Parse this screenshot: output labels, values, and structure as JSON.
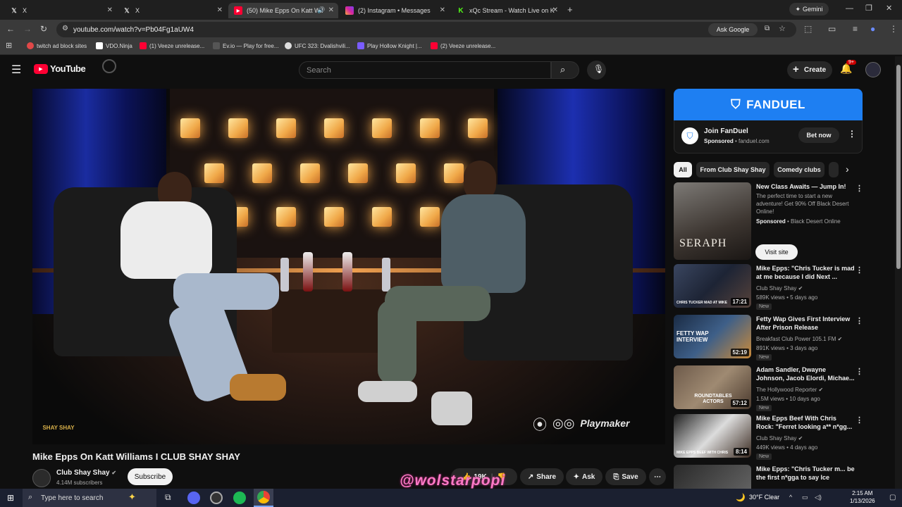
{
  "browser": {
    "tabs": [
      {
        "label": "X",
        "icon": "x-logo-icon"
      },
      {
        "label": "X",
        "icon": "x-logo-icon"
      },
      {
        "label": "(50) Mike Epps On Katt Wil",
        "icon": "youtube-icon"
      },
      {
        "label": "(2) Instagram • Messages",
        "icon": "instagram-icon"
      },
      {
        "label": "xQc Stream - Watch Live on K",
        "icon": "kick-icon"
      }
    ],
    "gemini_label": "Gemini",
    "url": "youtube.com/watch?v=Pb04Fg1aUW4",
    "ask_google": "Ask Google",
    "bookmarks": [
      "twitch ad block sites",
      "VDO.Ninja",
      "(1) Veeze unrelease...",
      "Ev.io — Play for free...",
      "UFC 323: Dvalishvili...",
      "Play Hollow Knight |...",
      "(2) Veeze unrelease..."
    ]
  },
  "youtube": {
    "logo_text": "YouTube",
    "search_placeholder": "Search",
    "create_label": "Create",
    "notif_count": "9+"
  },
  "video": {
    "title": "Mike Epps On Katt Williams I CLUB SHAY SHAY",
    "channel": "Club Shay Shay",
    "subscribers": "4.14M subscribers",
    "subscribe_label": "Subscribe",
    "like_count": "19K",
    "share_label": "Share",
    "ask_label": "Ask",
    "save_label": "Save",
    "overlay_logo": "SHAY SHAY",
    "overlay_brand": "Playmaker"
  },
  "ad": {
    "brand": "FANDUEL",
    "title": "Join FanDuel",
    "sponsored": "Sponsored",
    "domain": "fanduel.com",
    "cta": "Bet now"
  },
  "chips": [
    "All",
    "From Club Shay Shay",
    "Comedy clubs"
  ],
  "recommendations": [
    {
      "title": "New Class Awaits — Jump In!",
      "desc": "The perfect time to start a new adventure! Get 90% Off Black Desert Online!",
      "sponsored": "Sponsored",
      "advertiser": "Black Desert Online",
      "cta": "Visit site",
      "thumb_text": "SERAPH"
    },
    {
      "title": "Mike Epps: \"Chris Tucker is mad at me because I did Next ...",
      "channel": "Club Shay Shay",
      "meta": "589K views • 5 days ago",
      "badge": "New",
      "duration": "17:21",
      "thumb_text": "CHRIS TUCKER MAD AT MIKE"
    },
    {
      "title": "Fetty Wap Gives First Interview After Prison Release",
      "channel": "Breakfast Club Power 105.1 FM",
      "meta": "891K views • 3 days ago",
      "badge": "New",
      "duration": "52:19",
      "thumb_text": "FETTY WAP INTERVIEW"
    },
    {
      "title": "Adam Sandler, Dwayne Johnson, Jacob Elordi, Michae...",
      "channel": "The Hollywood Reporter",
      "meta": "1.5M views • 10 days ago",
      "badge": "New",
      "duration": "57:12",
      "thumb_text": "ROUNDTABLES ACTORS"
    },
    {
      "title": "Mike Epps Beef With Chris Rock: \"Ferret looking a** n*gg...",
      "channel": "Club Shay Shay",
      "meta": "449K views • 4 days ago",
      "badge": "New",
      "duration": "8:14",
      "thumb_text": "MIKE EPPS BEEF WITH CHRIS"
    },
    {
      "title": "Mike Epps: \"Chris Tucker m... be the first n*gga to say Ice",
      "channel": "Club Shay Shay",
      "meta": "",
      "badge": "",
      "duration": "",
      "thumb_text": ""
    }
  ],
  "taskbar": {
    "search_placeholder": "Type here to search",
    "weather": "30°F Clear",
    "time": "2:15 AM",
    "date": "1/13/2026"
  },
  "watermark": "@wolstarpopi",
  "colors": {
    "fanduel_blue": "#1e7ff2",
    "youtube_red": "#ff0033",
    "watermark_pink": "#ff7ac6"
  }
}
